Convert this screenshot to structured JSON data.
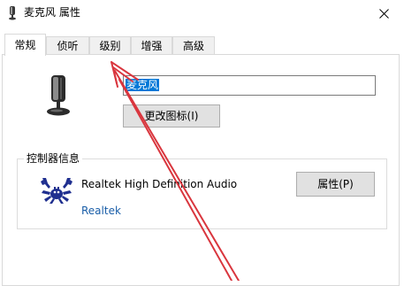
{
  "window": {
    "title": "麦克风 属性"
  },
  "tabs": [
    {
      "label": "常规"
    },
    {
      "label": "侦听"
    },
    {
      "label": "级别"
    },
    {
      "label": "增强"
    },
    {
      "label": "高级"
    }
  ],
  "general": {
    "device_name_value": "麦克风",
    "change_icon_label": "更改图标(I)",
    "controller_group_label": "控制器信息",
    "controller_name": "Realtek High Definition Audio",
    "controller_vendor": "Realtek",
    "properties_label": "属性(P)"
  },
  "icons": {
    "window_icon": "microphone-icon",
    "close": "close-icon",
    "device": "microphone-icon",
    "vendor_logo": "realtek-crab-logo"
  },
  "annotation": {
    "color": "#d9363e"
  }
}
